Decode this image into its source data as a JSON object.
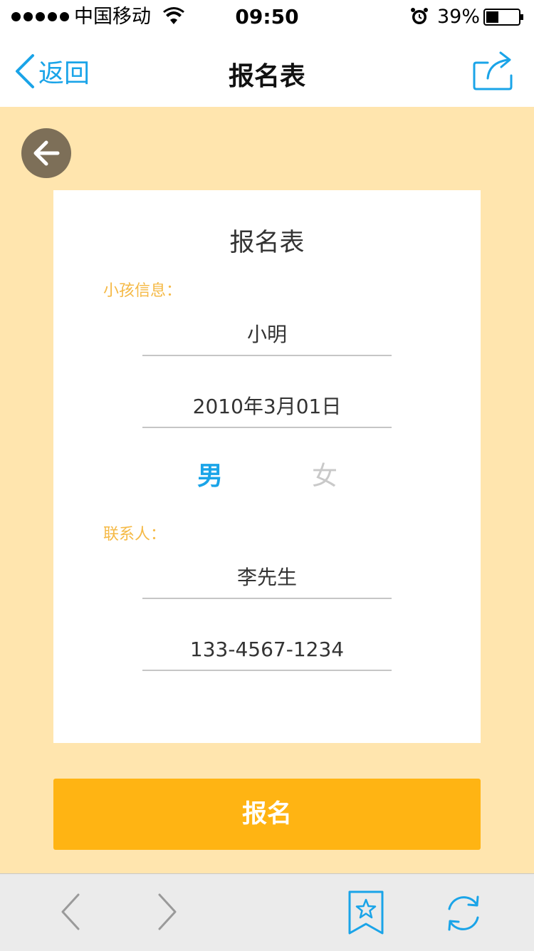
{
  "status_bar": {
    "carrier": "中国移动",
    "time": "09:50",
    "battery_percent": "39%",
    "battery_level": 0.39,
    "signal_bars": 5,
    "icons": [
      "signal-dots",
      "wifi-icon",
      "alarm-icon",
      "battery-icon"
    ]
  },
  "nav": {
    "back_label": "返回",
    "title": "报名表",
    "share_icon": "share-icon"
  },
  "form": {
    "title": "报名表",
    "child_section_label": "小孩信息：",
    "child_name": "小明",
    "birth_date": "2010年3月01日",
    "gender_male": "男",
    "gender_female": "女",
    "selected_gender": "男",
    "contact_section_label": "联系人：",
    "contact_name": "李先生",
    "phone": "133-4567-1234"
  },
  "submit": {
    "label": "报名"
  },
  "toolbar": {
    "icons": [
      "chevron-left-icon",
      "chevron-right-icon",
      "bookmark-star-icon",
      "refresh-icon"
    ]
  },
  "colors": {
    "page_bg": "#ffe5ae",
    "accent_blue": "#1aa4e8",
    "button_orange": "#ffb413",
    "label_orange": "#f5b945",
    "back_circle": "#7d6f58",
    "toolbar_bg": "#ebebeb"
  }
}
